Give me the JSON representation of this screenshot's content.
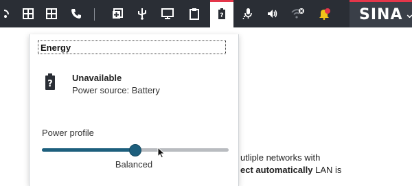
{
  "taskbar": {
    "brand": "SINA",
    "icons": [
      "grid-icon",
      "grid-icon",
      "phone-icon",
      "stack-icon",
      "usb-icon",
      "monitor-icon",
      "clipboard-icon",
      "battery-icon",
      "microphone-icon",
      "volume-icon",
      "wifi-off-icon",
      "notification-icon"
    ],
    "accent": "#e4364a"
  },
  "energy_panel": {
    "title": "Energy",
    "status": "Unavailable",
    "power_source": "Power source: Battery",
    "profile_label": "Power profile",
    "profile_value": "Balanced",
    "slider_level": 0.5
  },
  "background": {
    "line1": "utliple networks with",
    "line2_bold": "ect automatically",
    "line2_rest": " LAN is"
  }
}
